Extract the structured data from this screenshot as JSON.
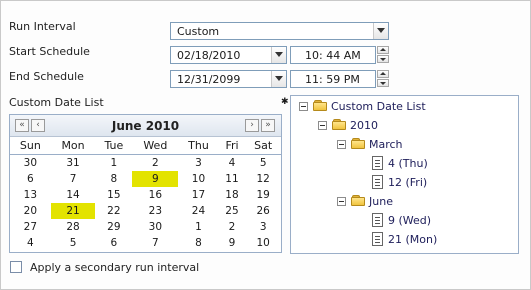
{
  "form": {
    "run_interval_label": "Run Interval",
    "run_interval_value": "Custom",
    "start_schedule_label": "Start Schedule",
    "start_date": "02/18/2010",
    "start_time": "10: 44 AM",
    "end_schedule_label": "End Schedule",
    "end_date": "12/31/2099",
    "end_time": "11: 59 PM",
    "custom_date_list_label": "Custom Date List"
  },
  "calendar": {
    "month_title": "June 2010",
    "nav": {
      "first": "«",
      "prev": "‹",
      "next": "›",
      "last": "»"
    },
    "weekdays": [
      "Sun",
      "Mon",
      "Tue",
      "Wed",
      "Thu",
      "Fri",
      "Sat"
    ],
    "weeks": [
      [
        "30",
        "31",
        "1",
        "2",
        "3",
        "4",
        "5"
      ],
      [
        "6",
        "7",
        "8",
        "9",
        "10",
        "11",
        "12"
      ],
      [
        "13",
        "14",
        "15",
        "16",
        "17",
        "18",
        "19"
      ],
      [
        "20",
        "21",
        "22",
        "23",
        "24",
        "25",
        "26"
      ],
      [
        "27",
        "28",
        "29",
        "30",
        "1",
        "2",
        "3"
      ],
      [
        "4",
        "5",
        "6",
        "7",
        "8",
        "9",
        "10"
      ]
    ],
    "highlight_color": "#e3e300",
    "highlighted_days": [
      "9",
      "21"
    ]
  },
  "tree": {
    "root": "Custom Date List",
    "year": "2010",
    "month1": "March",
    "march_dates": [
      "4 (Thu)",
      "12 (Fri)"
    ],
    "month2": "June",
    "june_dates": [
      "9 (Wed)",
      "21 (Mon)"
    ]
  },
  "secondary_interval_label": "Apply a secondary run interval",
  "colors": {
    "border": "#7f9db9",
    "accent": "#1e1e5a"
  }
}
